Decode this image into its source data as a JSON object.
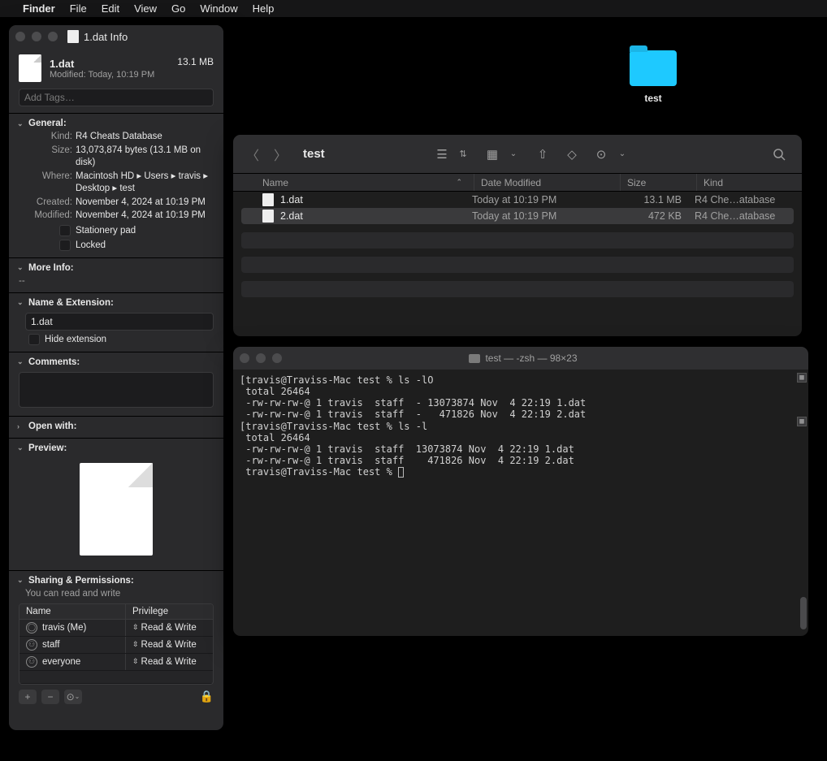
{
  "menubar": {
    "app": "Finder",
    "items": [
      "File",
      "Edit",
      "View",
      "Go",
      "Window",
      "Help"
    ]
  },
  "desktop": {
    "folder_label": "test"
  },
  "info": {
    "window_title": "1.dat Info",
    "file_name": "1.dat",
    "file_size_short": "13.1 MB",
    "modified_line_label": "Modified:",
    "modified_line_value": "Today, 10:19 PM",
    "tags_placeholder": "Add Tags…",
    "sections": {
      "general": "General:",
      "moreinfo": "More Info:",
      "name_ext": "Name & Extension:",
      "comments": "Comments:",
      "openwith": "Open with:",
      "preview": "Preview:",
      "sharing": "Sharing & Permissions:"
    },
    "general": {
      "kind_k": "Kind:",
      "kind_v": "R4 Cheats Database",
      "size_k": "Size:",
      "size_v": "13,073,874 bytes (13.1 MB on disk)",
      "where_k": "Where:",
      "where_v": "Macintosh HD ▸ Users ▸ travis ▸ Desktop ▸ test",
      "created_k": "Created:",
      "created_v": "November 4, 2024 at 10:19 PM",
      "modified_k": "Modified:",
      "modified_v": "November 4, 2024 at 10:19 PM",
      "stationery": "Stationery pad",
      "locked": "Locked"
    },
    "moreinfo_dash": "--",
    "name_ext_value": "1.dat",
    "hide_ext": "Hide extension",
    "perm_summary": "You can read and write",
    "perm_head_name": "Name",
    "perm_head_priv": "Privilege",
    "perm_rows": [
      {
        "name": "travis (Me)",
        "priv": "Read & Write"
      },
      {
        "name": "staff",
        "priv": "Read & Write"
      },
      {
        "name": "everyone",
        "priv": "Read & Write"
      }
    ]
  },
  "finder": {
    "title": "test",
    "cols": {
      "name": "Name",
      "date": "Date Modified",
      "size": "Size",
      "kind": "Kind"
    },
    "rows": [
      {
        "name": "1.dat",
        "date": "Today at 10:19 PM",
        "size": "13.1 MB",
        "kind": "R4 Che…atabase",
        "selected": false
      },
      {
        "name": "2.dat",
        "date": "Today at 10:19 PM",
        "size": "472 KB",
        "kind": "R4 Che…atabase",
        "selected": true
      }
    ]
  },
  "terminal": {
    "title": "test — -zsh — 98×23",
    "lines": [
      "[travis@Traviss-Mac test % ls -lO                                                                 ]",
      " total 26464",
      " -rw-rw-rw-@ 1 travis  staff  - 13073874 Nov  4 22:19 1.dat",
      " -rw-rw-rw-@ 1 travis  staff  -   471826 Nov  4 22:19 2.dat",
      "[travis@Traviss-Mac test % ls -l                                                                  ]",
      " total 26464",
      " -rw-rw-rw-@ 1 travis  staff  13073874 Nov  4 22:19 1.dat",
      " -rw-rw-rw-@ 1 travis  staff    471826 Nov  4 22:19 2.dat",
      " travis@Traviss-Mac test % "
    ]
  }
}
